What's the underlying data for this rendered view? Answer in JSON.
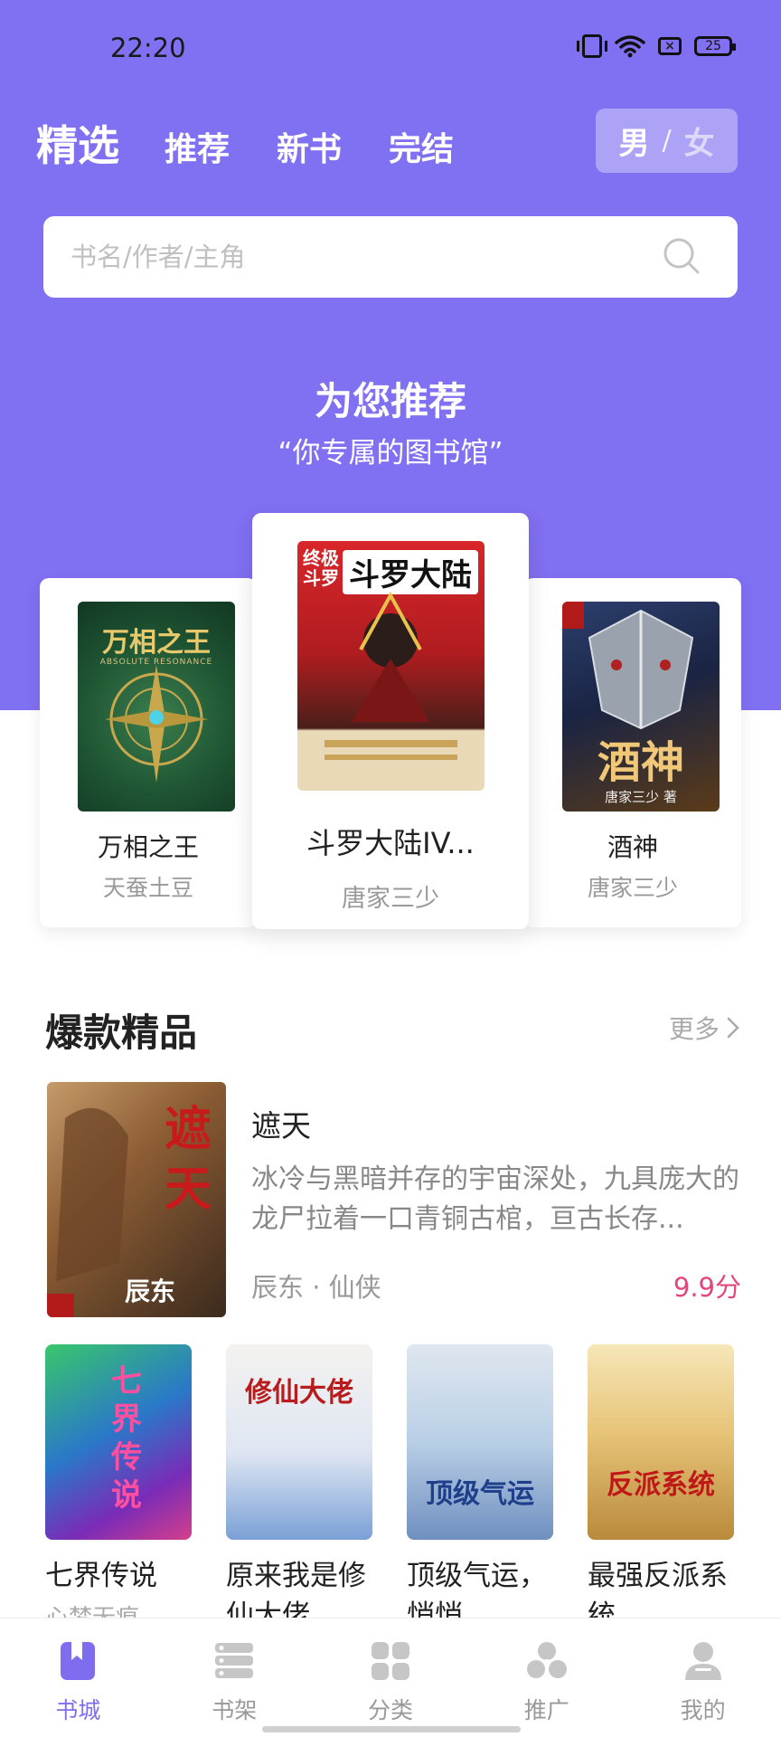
{
  "status_bar": {
    "time": "22:20",
    "battery": "25"
  },
  "header": {
    "tabs": [
      {
        "label": "精选",
        "active": true
      },
      {
        "label": "推荐",
        "active": false
      },
      {
        "label": "新书",
        "active": false
      },
      {
        "label": "完结",
        "active": false
      }
    ],
    "gender_male": "男",
    "gender_separator": "/",
    "gender_female": "女"
  },
  "search": {
    "placeholder": "书名/作者/主角"
  },
  "recommend": {
    "title": "为您推荐",
    "subtitle": "“你专属的图书馆”",
    "books": [
      {
        "title": "万相之王",
        "author": "天蚕土豆",
        "cover_text": "万相之王",
        "cover_sub": "ABSOLUTE RESONANCE"
      },
      {
        "title": "斗罗大陆IV...",
        "author": "唐家三少",
        "cover_text": "斗罗大陆",
        "cover_side": "终极斗罗"
      },
      {
        "title": "酒神",
        "author": "唐家三少",
        "cover_text": "酒神",
        "cover_sub": "唐家三少 著"
      }
    ]
  },
  "section": {
    "title": "爆款精品",
    "more_label": "更多",
    "featured": {
      "title": "遮天",
      "description": "冰冷与黑暗并存的宇宙深处，九具庞大的龙尸拉着一口青铜古棺，亘古长存...",
      "meta": "辰东 · 仙侠",
      "score": "9.9分",
      "cover_text": "遮天",
      "cover_author": "辰东"
    },
    "grid": [
      {
        "title": "七界传说",
        "author": "心梦无痕",
        "cover_text": "七界传说"
      },
      {
        "title": "原来我是修仙大佬",
        "author": "",
        "cover_text": "修仙大佬"
      },
      {
        "title": "顶级气运，悄悄",
        "author": "",
        "cover_text": "顶级气运"
      },
      {
        "title": "最强反派系统",
        "author": "",
        "cover_text": "反派系统"
      }
    ]
  },
  "bottom_nav": [
    {
      "label": "书城",
      "icon": "bookmark-book-icon",
      "active": true
    },
    {
      "label": "书架",
      "icon": "shelf-icon",
      "active": false
    },
    {
      "label": "分类",
      "icon": "category-grid-icon",
      "active": false
    },
    {
      "label": "推广",
      "icon": "promote-share-icon",
      "active": false
    },
    {
      "label": "我的",
      "icon": "profile-icon",
      "active": false
    }
  ],
  "colors": {
    "brand": "#8070F2",
    "score": "#E2477C",
    "active_nav": "#7F6DF0"
  }
}
